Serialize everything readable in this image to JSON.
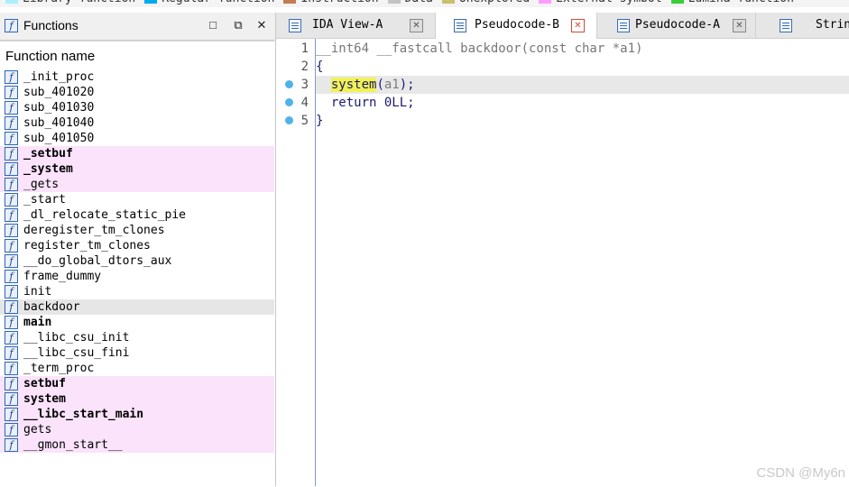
{
  "legend": {
    "items": [
      {
        "label": "Library function",
        "color": "#aaf0ff"
      },
      {
        "label": "Regular function",
        "color": "#00a9f0"
      },
      {
        "label": "Instruction",
        "color": "#c47b51"
      },
      {
        "label": "Data",
        "color": "#c3c3c3"
      },
      {
        "label": "Unexplored",
        "color": "#c8c06a"
      },
      {
        "label": "External symbol",
        "color": "#ff9aff"
      },
      {
        "label": "Lumina function",
        "color": "#39cf39"
      }
    ]
  },
  "functions_panel": {
    "title": "Functions",
    "column_header": "Function name",
    "rows": [
      {
        "name": "_init_proc",
        "style": "normal"
      },
      {
        "name": "sub_401020",
        "style": "normal"
      },
      {
        "name": "sub_401030",
        "style": "normal"
      },
      {
        "name": "sub_401040",
        "style": "normal"
      },
      {
        "name": "sub_401050",
        "style": "normal"
      },
      {
        "name": "_setbuf",
        "style": "lib-bold"
      },
      {
        "name": "_system",
        "style": "lib-bold"
      },
      {
        "name": "_gets",
        "style": "lib"
      },
      {
        "name": "_start",
        "style": "normal"
      },
      {
        "name": "_dl_relocate_static_pie",
        "style": "normal"
      },
      {
        "name": "deregister_tm_clones",
        "style": "normal"
      },
      {
        "name": "register_tm_clones",
        "style": "normal"
      },
      {
        "name": "__do_global_dtors_aux",
        "style": "normal"
      },
      {
        "name": "frame_dummy",
        "style": "normal"
      },
      {
        "name": "init",
        "style": "normal"
      },
      {
        "name": "backdoor",
        "style": "selected"
      },
      {
        "name": "main",
        "style": "bold"
      },
      {
        "name": "__libc_csu_init",
        "style": "normal"
      },
      {
        "name": "__libc_csu_fini",
        "style": "normal"
      },
      {
        "name": "_term_proc",
        "style": "normal"
      },
      {
        "name": "setbuf",
        "style": "lib-bold"
      },
      {
        "name": "system",
        "style": "lib-bold"
      },
      {
        "name": "__libc_start_main",
        "style": "lib-bold"
      },
      {
        "name": "gets",
        "style": "lib"
      },
      {
        "name": "__gmon_start__",
        "style": "lib"
      }
    ]
  },
  "tabs": [
    {
      "label": "IDA View-A"
    },
    {
      "label": "Pseudocode-B"
    },
    {
      "label": "Pseudocode-A"
    },
    {
      "label": "Strin"
    }
  ],
  "editor": {
    "lines": [
      {
        "num": "1",
        "breakpoint": false,
        "prefix": "__int64 __fastcall backdoor(const char *a1)",
        "call": "",
        "arg": "",
        "suffix": ""
      },
      {
        "num": "2",
        "breakpoint": false,
        "prefix": "{",
        "call": "",
        "arg": "",
        "suffix": ""
      },
      {
        "num": "3",
        "breakpoint": true,
        "prefix": "  ",
        "call": "system",
        "arg": "a1",
        "suffix": ");"
      },
      {
        "num": "4",
        "breakpoint": true,
        "prefix": "  return 0LL;",
        "call": "",
        "arg": "",
        "suffix": ""
      },
      {
        "num": "5",
        "breakpoint": true,
        "prefix": "}",
        "call": "",
        "arg": "",
        "suffix": ""
      }
    ],
    "paren_open": "("
  },
  "watermark": "CSDN @My6n"
}
